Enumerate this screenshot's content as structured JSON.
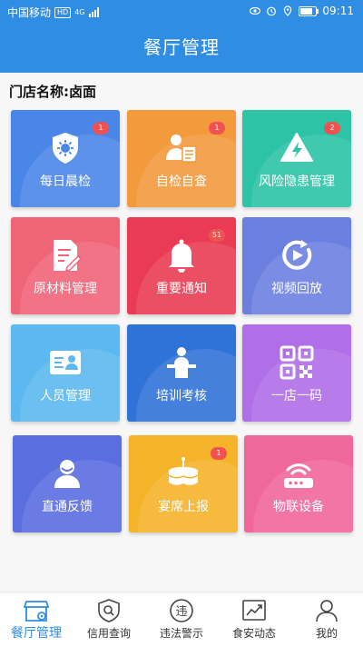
{
  "status_bar": {
    "carrier": "中国移动",
    "hd": "HD",
    "network": "4G",
    "time": "09:11"
  },
  "header": {
    "title": "餐厅管理"
  },
  "store": {
    "label": "门店名称:卤面"
  },
  "tiles": [
    {
      "label": "每日晨检",
      "badge": "1",
      "color": "#4a86e8",
      "icon": "virus-shield-icon"
    },
    {
      "label": "自检自查",
      "badge": "1",
      "color": "#f39a3d",
      "icon": "self-check-icon"
    },
    {
      "label": "风险隐患管理",
      "badge": "2",
      "color": "#2cc3a6",
      "icon": "warning-icon"
    },
    {
      "label": "原材料管理",
      "badge": "",
      "color": "#f06478",
      "icon": "document-edit-icon"
    },
    {
      "label": "重要通知",
      "badge": "51",
      "color": "#e93b53",
      "icon": "bell-icon"
    },
    {
      "label": "视频回放",
      "badge": "",
      "color": "#6b7fe0",
      "icon": "video-replay-icon"
    },
    {
      "label": "人员管理",
      "badge": "",
      "color": "#5cb8f0",
      "icon": "id-card-icon"
    },
    {
      "label": "培训考核",
      "badge": "",
      "color": "#2f72d8",
      "icon": "podium-icon"
    },
    {
      "label": "一店一码",
      "badge": "",
      "color": "#b06ee8",
      "icon": "qr-code-icon"
    },
    {
      "label": "直通反馈",
      "badge": "",
      "color": "#5a6ee0",
      "icon": "user-feedback-icon"
    },
    {
      "label": "宴席上报",
      "badge": "1",
      "color": "#f5b32a",
      "icon": "banquet-table-icon"
    },
    {
      "label": "物联设备",
      "badge": "",
      "color": "#f0679b",
      "icon": "router-icon"
    }
  ],
  "tabs": [
    {
      "label": "餐厅管理",
      "active": true,
      "icon": "restaurant-gear-icon"
    },
    {
      "label": "信用查询",
      "active": false,
      "icon": "shield-search-icon"
    },
    {
      "label": "违法警示",
      "active": false,
      "icon": "violation-icon"
    },
    {
      "label": "食安动态",
      "active": false,
      "icon": "trend-chart-icon"
    },
    {
      "label": "我的",
      "active": false,
      "icon": "user-icon"
    }
  ]
}
